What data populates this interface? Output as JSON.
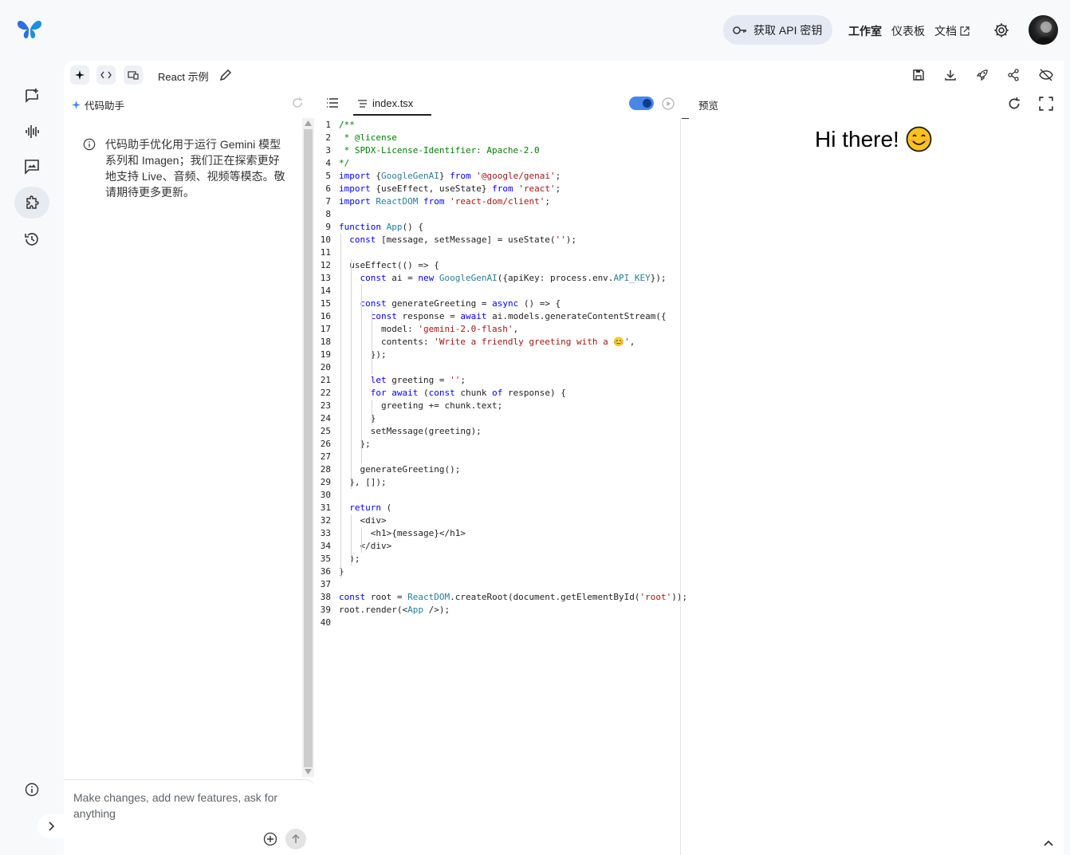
{
  "header": {
    "api_key_label": "获取 API 密钥",
    "nav": [
      "工作室",
      "仪表板",
      "文档"
    ]
  },
  "toolbar": {
    "project_title": "React 示例"
  },
  "assistant": {
    "title": "代码助手",
    "notice": "代码助手优化用于运行 Gemini 模型系列和 Imagen；我们正在探索更好地支持 Live、音频、视频等模态。敬请期待更多更新。",
    "input_placeholder": "Make changes, add new features, ask for anything"
  },
  "editor": {
    "file_name": "index.tsx",
    "toggle_on": true,
    "lines": [
      "/**",
      " * @license",
      " * SPDX-License-Identifier: Apache-2.0",
      "*/",
      "import {GoogleGenAI} from '@google/genai';",
      "import {useEffect, useState} from 'react';",
      "import ReactDOM from 'react-dom/client';",
      "",
      "function App() {",
      "  const [message, setMessage] = useState('');",
      "",
      "  useEffect(() => {",
      "    const ai = new GoogleGenAI({apiKey: process.env.API_KEY});",
      "",
      "    const generateGreeting = async () => {",
      "      const response = await ai.models.generateContentStream({",
      "        model: 'gemini-2.0-flash',",
      "        contents: 'Write a friendly greeting with a 😊',",
      "      });",
      "",
      "      let greeting = '';",
      "      for await (const chunk of response) {",
      "        greeting += chunk.text;",
      "      }",
      "      setMessage(greeting);",
      "    };",
      "",
      "    generateGreeting();",
      "  }, []);",
      "",
      "  return (",
      "    <div>",
      "      <h1>{message}</h1>",
      "    </div>",
      "  );",
      "}",
      "",
      "const root = ReactDOM.createRoot(document.getElementById('root'));",
      "root.render(<App />);",
      ""
    ]
  },
  "preview": {
    "label": "预览",
    "heading": "Hi there!",
    "emoji": "😊"
  }
}
